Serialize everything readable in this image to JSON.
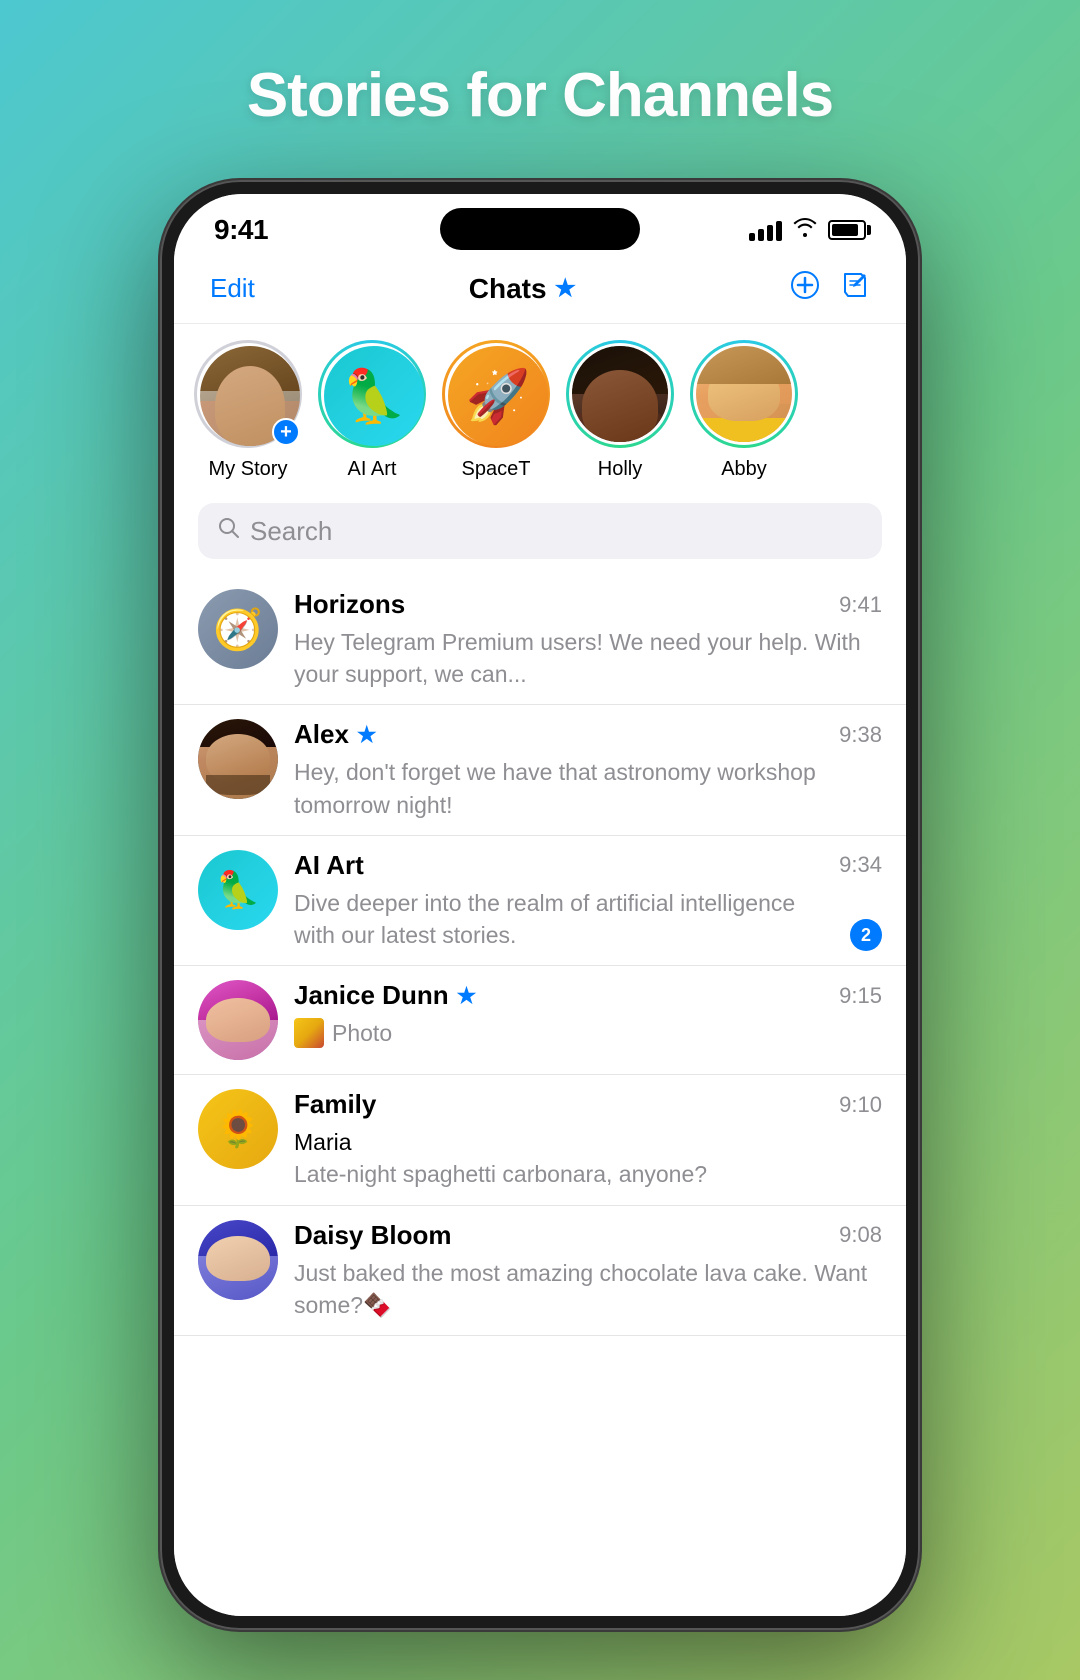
{
  "hero": {
    "title": "Stories for Channels"
  },
  "status_bar": {
    "time": "9:41",
    "signal_bars": [
      8,
      12,
      16,
      20
    ],
    "wifi": "wifi",
    "battery_level": 85
  },
  "nav": {
    "edit_label": "Edit",
    "title": "Chats",
    "add_icon": "+",
    "compose_icon": "compose"
  },
  "stories": [
    {
      "id": "my-story",
      "label": "My Story",
      "type": "my-story",
      "has_add": true
    },
    {
      "id": "ai-art",
      "label": "AI Art",
      "type": "ai-art",
      "has_ring": true,
      "emoji": "🦜"
    },
    {
      "id": "spacet",
      "label": "SpaceT",
      "type": "spacet",
      "has_ring": true,
      "emoji": "🚀"
    },
    {
      "id": "holly",
      "label": "Holly",
      "type": "holly",
      "has_ring": true
    },
    {
      "id": "abby",
      "label": "Abby",
      "type": "abby",
      "has_ring": true
    }
  ],
  "search": {
    "placeholder": "Search"
  },
  "chats": [
    {
      "id": "horizons",
      "name": "Horizons",
      "time": "9:41",
      "preview": "Hey Telegram Premium users!  We need your help. With your support, we can...",
      "type": "horizons",
      "unread": 0,
      "starred": false,
      "emoji": "🧭"
    },
    {
      "id": "alex",
      "name": "Alex",
      "time": "9:38",
      "preview": "Hey, don't forget we have that astronomy workshop tomorrow night!",
      "type": "alex",
      "unread": 0,
      "starred": true
    },
    {
      "id": "ai-art",
      "name": "AI Art",
      "time": "9:34",
      "preview": "Dive deeper into the realm of artificial intelligence with our latest stories.",
      "type": "ai-art-list",
      "unread": 2,
      "starred": false,
      "emoji": "🦜"
    },
    {
      "id": "janice",
      "name": "Janice Dunn",
      "time": "9:15",
      "preview_type": "photo",
      "preview": "Photo",
      "type": "janice",
      "unread": 0,
      "starred": true
    },
    {
      "id": "family",
      "name": "Family",
      "time": "9:10",
      "preview": "Maria\nLate-night spaghetti carbonara, anyone?",
      "preview_line1": "Maria",
      "preview_line2": "Late-night spaghetti carbonara, anyone?",
      "type": "family",
      "unread": 0,
      "starred": false,
      "emoji": "🌻"
    },
    {
      "id": "daisy",
      "name": "Daisy Bloom",
      "time": "9:08",
      "preview": "Just baked the most amazing chocolate lava cake. Want some?🍫",
      "type": "daisy",
      "unread": 0,
      "starred": false
    }
  ]
}
